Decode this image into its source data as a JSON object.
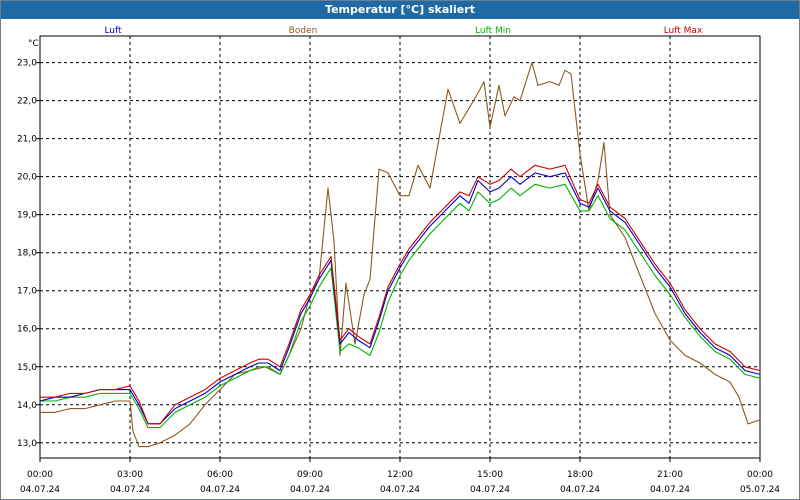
{
  "window": {
    "title": "Temperatur [°C] skaliert"
  },
  "colors": {
    "title_bar": "#1f6aa5",
    "background": "#ffffff",
    "grid": "#000000"
  },
  "chart_data": {
    "type": "line",
    "title": "Temperatur [°C] skaliert",
    "ylabel": "°C",
    "ylim": [
      12.6,
      23.7
    ],
    "yticks": [
      13.0,
      14.0,
      15.0,
      16.0,
      17.0,
      18.0,
      19.0,
      20.0,
      21.0,
      22.0,
      23.0
    ],
    "ytick_labels": [
      "13,0",
      "14,0",
      "15,0",
      "16,0",
      "17,0",
      "18,0",
      "19,0",
      "20,0",
      "21,0",
      "22,0",
      "23,0"
    ],
    "xlim": [
      0,
      24
    ],
    "xtick_hours": [
      0,
      3,
      6,
      9,
      12,
      15,
      18,
      21,
      24
    ],
    "xtick_times": [
      "00:00",
      "03:00",
      "06:00",
      "09:00",
      "12:00",
      "15:00",
      "18:00",
      "21:00",
      "00:00"
    ],
    "xtick_dates": [
      "04.07.24",
      "04.07.24",
      "04.07.24",
      "04.07.24",
      "04.07.24",
      "04.07.24",
      "04.07.24",
      "04.07.24",
      "05.07.24"
    ],
    "grid": true,
    "legend_position": "top",
    "series": [
      {
        "name": "Luft",
        "color": "#0000c8",
        "x": [
          0,
          0.5,
          1,
          1.5,
          2,
          2.5,
          3,
          3.3,
          3.6,
          4,
          4.5,
          5,
          5.5,
          6,
          6.5,
          7,
          7.3,
          7.6,
          8,
          8.3,
          8.7,
          9,
          9.3,
          9.7,
          10,
          10.3,
          10.6,
          11,
          11.3,
          11.6,
          12,
          12.3,
          12.6,
          13,
          13.5,
          14,
          14.3,
          14.6,
          15,
          15.3,
          15.7,
          16,
          16.5,
          17,
          17.5,
          18,
          18.3,
          18.6,
          19,
          19.5,
          20,
          20.5,
          21,
          21.5,
          22,
          22.5,
          23,
          23.5,
          24
        ],
        "y": [
          14.1,
          14.2,
          14.2,
          14.3,
          14.4,
          14.4,
          14.4,
          14.0,
          13.5,
          13.5,
          13.9,
          14.1,
          14.3,
          14.6,
          14.8,
          15.0,
          15.1,
          15.1,
          14.9,
          15.5,
          16.4,
          16.8,
          17.3,
          17.8,
          15.6,
          15.9,
          15.7,
          15.5,
          16.2,
          17.0,
          17.6,
          18.0,
          18.3,
          18.7,
          19.1,
          19.5,
          19.3,
          19.9,
          19.6,
          19.7,
          20.0,
          19.8,
          20.1,
          20.0,
          20.1,
          19.3,
          19.2,
          19.7,
          19.1,
          18.8,
          18.2,
          17.6,
          17.1,
          16.4,
          15.9,
          15.5,
          15.3,
          14.9,
          14.8
        ]
      },
      {
        "name": "Boden",
        "color": "#8b5a1e",
        "x": [
          0,
          0.5,
          1,
          1.5,
          2,
          2.5,
          3,
          3.1,
          3.3,
          3.6,
          4,
          4.5,
          5,
          5.5,
          6,
          6.5,
          7,
          7.5,
          8,
          8.3,
          8.7,
          9,
          9.3,
          9.6,
          9.8,
          10,
          10.2,
          10.5,
          10.8,
          11,
          11.3,
          11.6,
          12,
          12.3,
          12.6,
          13,
          13.3,
          13.6,
          14,
          14.3,
          14.6,
          14.8,
          15,
          15.3,
          15.5,
          15.8,
          16,
          16.2,
          16.4,
          16.6,
          17,
          17.3,
          17.5,
          17.7,
          18,
          18.3,
          18.6,
          18.8,
          19,
          19.5,
          20,
          20.5,
          21,
          21.5,
          22,
          22.5,
          23,
          23.3,
          23.6,
          24
        ],
        "y": [
          13.8,
          13.8,
          13.9,
          13.9,
          14.0,
          14.1,
          14.1,
          13.3,
          12.9,
          12.9,
          13.0,
          13.2,
          13.5,
          14.0,
          14.4,
          14.8,
          14.9,
          15.0,
          14.8,
          15.3,
          16.0,
          16.9,
          17.3,
          19.7,
          18.3,
          15.3,
          17.2,
          15.6,
          16.9,
          17.3,
          20.2,
          20.1,
          19.5,
          19.5,
          20.3,
          19.7,
          21.0,
          22.3,
          21.4,
          21.8,
          22.2,
          22.5,
          21.3,
          22.4,
          21.6,
          22.1,
          22.0,
          22.5,
          23.0,
          22.4,
          22.5,
          22.4,
          22.8,
          22.7,
          20.6,
          19.1,
          19.9,
          20.9,
          19.0,
          18.4,
          17.4,
          16.4,
          15.7,
          15.3,
          15.1,
          14.8,
          14.6,
          14.2,
          13.5,
          13.6
        ]
      },
      {
        "name": "Luft Min",
        "color": "#00b400",
        "x": [
          0,
          0.5,
          1,
          1.5,
          2,
          2.5,
          3,
          3.3,
          3.6,
          4,
          4.5,
          5,
          5.5,
          6,
          6.5,
          7,
          7.3,
          7.6,
          8,
          8.3,
          8.7,
          9,
          9.3,
          9.7,
          10,
          10.3,
          10.6,
          11,
          11.3,
          11.6,
          12,
          12.3,
          12.6,
          13,
          13.5,
          14,
          14.3,
          14.6,
          15,
          15.3,
          15.7,
          16,
          16.5,
          17,
          17.5,
          18,
          18.3,
          18.6,
          19,
          19.5,
          20,
          20.5,
          21,
          21.5,
          22,
          22.5,
          23,
          23.5,
          24
        ],
        "y": [
          14.1,
          14.1,
          14.2,
          14.2,
          14.3,
          14.3,
          14.3,
          13.9,
          13.4,
          13.4,
          13.8,
          14.0,
          14.2,
          14.5,
          14.7,
          14.9,
          15.0,
          15.0,
          14.8,
          15.3,
          16.2,
          16.6,
          17.1,
          17.6,
          15.4,
          15.6,
          15.5,
          15.3,
          15.9,
          16.7,
          17.4,
          17.8,
          18.1,
          18.5,
          18.9,
          19.3,
          19.1,
          19.6,
          19.3,
          19.4,
          19.7,
          19.5,
          19.8,
          19.7,
          19.8,
          19.1,
          19.1,
          19.5,
          18.9,
          18.6,
          18.0,
          17.4,
          16.9,
          16.3,
          15.8,
          15.4,
          15.2,
          14.8,
          14.7
        ]
      },
      {
        "name": "Luft Max",
        "color": "#c80000",
        "x": [
          0,
          0.5,
          1,
          1.5,
          2,
          2.5,
          3,
          3.3,
          3.6,
          4,
          4.5,
          5,
          5.5,
          6,
          6.5,
          7,
          7.3,
          7.6,
          8,
          8.3,
          8.7,
          9,
          9.3,
          9.7,
          10,
          10.3,
          10.6,
          11,
          11.3,
          11.6,
          12,
          12.3,
          12.6,
          13,
          13.5,
          14,
          14.3,
          14.6,
          15,
          15.3,
          15.7,
          16,
          16.5,
          17,
          17.5,
          18,
          18.3,
          18.6,
          19,
          19.5,
          20,
          20.5,
          21,
          21.5,
          22,
          22.5,
          23,
          23.5,
          24
        ],
        "y": [
          14.2,
          14.2,
          14.3,
          14.3,
          14.4,
          14.4,
          14.5,
          14.1,
          13.5,
          13.5,
          14.0,
          14.2,
          14.4,
          14.7,
          14.9,
          15.1,
          15.2,
          15.2,
          15.0,
          15.6,
          16.5,
          16.9,
          17.4,
          17.9,
          15.7,
          16.0,
          15.8,
          15.6,
          16.3,
          17.1,
          17.7,
          18.1,
          18.4,
          18.8,
          19.2,
          19.6,
          19.5,
          20.0,
          19.8,
          19.9,
          20.2,
          20.0,
          20.3,
          20.2,
          20.3,
          19.4,
          19.3,
          19.8,
          19.2,
          18.9,
          18.3,
          17.7,
          17.2,
          16.5,
          16.0,
          15.6,
          15.4,
          15.0,
          14.9
        ]
      }
    ]
  }
}
